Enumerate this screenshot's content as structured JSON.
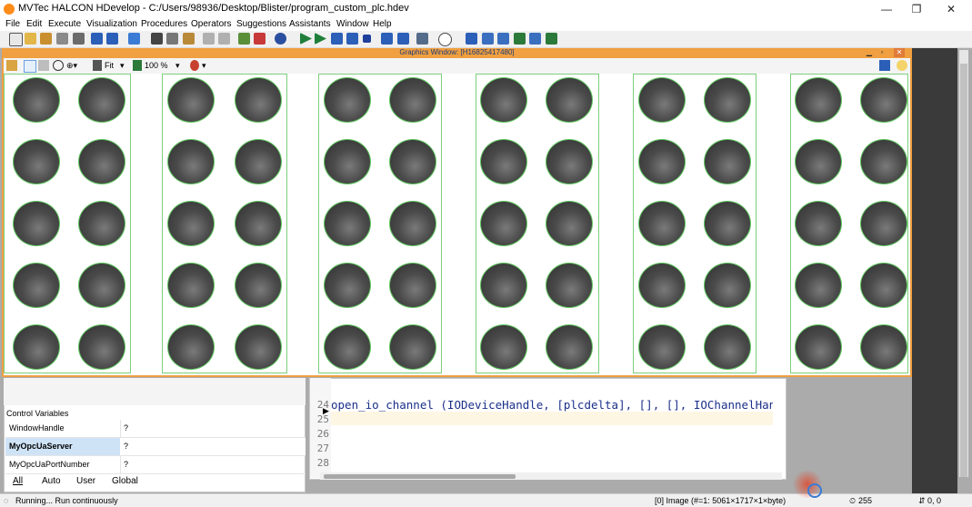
{
  "window": {
    "title": "MVTec HALCON HDevelop - C:/Users/98936/Desktop/Blister/program_custom_plc.hdev",
    "minimize": "—",
    "maximize": "❐",
    "close": "✕"
  },
  "menu": [
    "File",
    "Edit",
    "Execute",
    "Visualization",
    "Procedures",
    "Operators",
    "Suggestions",
    "Assistants",
    "Window",
    "Help"
  ],
  "graphics_window": {
    "title": "Graphics Window: [H16825417480]",
    "zoom_fit_label": "Fit",
    "zoom_percent": "100 %",
    "minimize": "▁",
    "restore": "▫",
    "close": "✕"
  },
  "variables": {
    "section_label": "Control Variables",
    "rows": [
      {
        "name": "WindowHandle",
        "value": "?"
      },
      {
        "name": "MyOpcUaServer",
        "value": "?"
      },
      {
        "name": "MyOpcUaPortNumber",
        "value": "?"
      }
    ],
    "tabs": [
      "All",
      "Auto",
      "User",
      "Global"
    ]
  },
  "program": {
    "line_numbers": [
      "24",
      "25",
      "26",
      "27",
      "28"
    ],
    "current_line_number": "24",
    "code_line": "open_io_channel (IODeviceHandle, [plcdelta], [], [], IOChannelHandle"
  },
  "status": {
    "message": "Running... Run continuously",
    "image_info": "[0] Image (#=1: 5061×1717×1×byte)",
    "gray_value": "255",
    "coords": "0, 0"
  },
  "colors": {
    "graphics_frame": "#f0a040",
    "region_outline": "#5fc75f",
    "code_text": "#1a2f8a",
    "selected_var_bg": "#cfe3f7"
  }
}
